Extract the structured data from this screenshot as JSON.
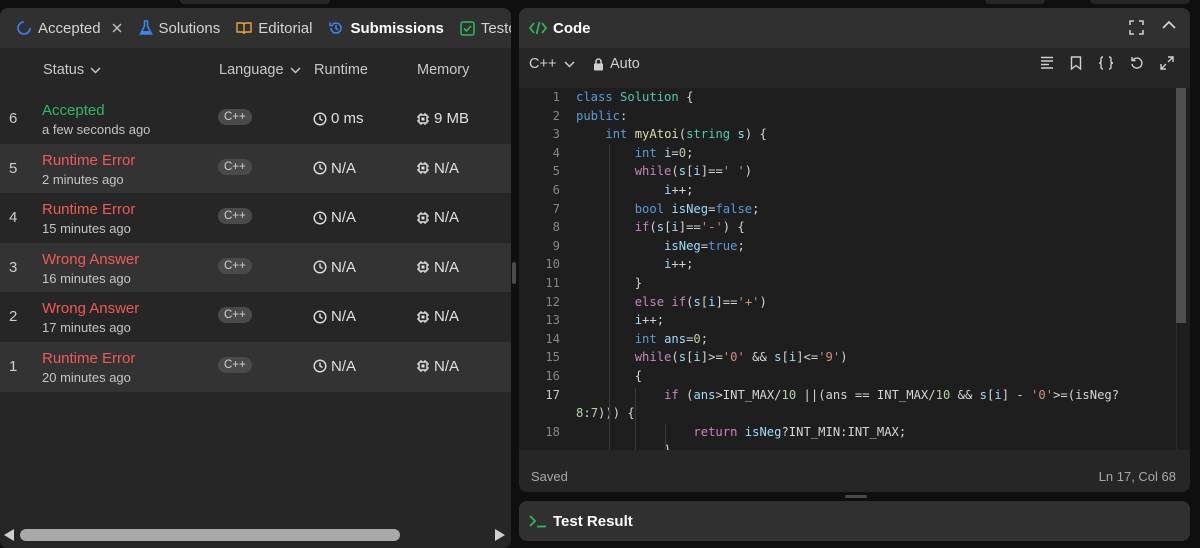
{
  "left_panel": {
    "tabs": [
      {
        "label": "Accepted",
        "icon": "history-icon"
      },
      {
        "label": "Solutions",
        "icon": "flask-icon"
      },
      {
        "label": "Editorial",
        "icon": "book-icon"
      },
      {
        "label": "Submissions",
        "icon": "history-icon"
      },
      {
        "label": "Testca",
        "icon": "check-box-icon"
      }
    ],
    "columns": {
      "status": "Status",
      "language": "Language",
      "runtime": "Runtime",
      "memory": "Memory"
    },
    "submissions": [
      {
        "num": "6",
        "status": "Accepted",
        "time": "a few seconds ago",
        "lang": "C++",
        "runtime": "0 ms",
        "memory": "9 MB"
      },
      {
        "num": "5",
        "status": "Runtime Error",
        "time": "2 minutes ago",
        "lang": "C++",
        "runtime": "N/A",
        "memory": "N/A"
      },
      {
        "num": "4",
        "status": "Runtime Error",
        "time": "15 minutes ago",
        "lang": "C++",
        "runtime": "N/A",
        "memory": "N/A"
      },
      {
        "num": "3",
        "status": "Wrong Answer",
        "time": "16 minutes ago",
        "lang": "C++",
        "runtime": "N/A",
        "memory": "N/A"
      },
      {
        "num": "2",
        "status": "Wrong Answer",
        "time": "17 minutes ago",
        "lang": "C++",
        "runtime": "N/A",
        "memory": "N/A"
      },
      {
        "num": "1",
        "status": "Runtime Error",
        "time": "20 minutes ago",
        "lang": "C++",
        "runtime": "N/A",
        "memory": "N/A"
      }
    ]
  },
  "code_panel": {
    "title": "Code",
    "language": "C++",
    "mode": "Auto",
    "status": "Saved",
    "cursor": "Ln 17, Col 68",
    "current_line": 17,
    "lines": [
      {
        "n": "1",
        "t": [
          [
            "kw",
            "class"
          ],
          [
            "op",
            " "
          ],
          [
            "type",
            "Solution"
          ],
          [
            "op",
            " {"
          ]
        ]
      },
      {
        "n": "2",
        "t": [
          [
            "kw",
            "public"
          ],
          [
            "op",
            ":"
          ]
        ]
      },
      {
        "n": "3",
        "t": [
          [
            "op",
            "    "
          ],
          [
            "kw",
            "int"
          ],
          [
            "op",
            " "
          ],
          [
            "fn",
            "myAtoi"
          ],
          [
            "op",
            "("
          ],
          [
            "type",
            "string"
          ],
          [
            "op",
            " "
          ],
          [
            "var",
            "s"
          ],
          [
            "op",
            ") {"
          ]
        ]
      },
      {
        "n": "4",
        "t": [
          [
            "op",
            "        "
          ],
          [
            "kw",
            "int"
          ],
          [
            "op",
            " "
          ],
          [
            "var",
            "i"
          ],
          [
            "op",
            "="
          ],
          [
            "num",
            "0"
          ],
          [
            "op",
            ";"
          ]
        ]
      },
      {
        "n": "5",
        "t": [
          [
            "op",
            "        "
          ],
          [
            "ctl",
            "while"
          ],
          [
            "op",
            "("
          ],
          [
            "var",
            "s"
          ],
          [
            "op",
            "["
          ],
          [
            "var",
            "i"
          ],
          [
            "op",
            "]=="
          ],
          [
            "str",
            "' '"
          ],
          [
            "op",
            ")"
          ]
        ]
      },
      {
        "n": "6",
        "t": [
          [
            "op",
            "            "
          ],
          [
            "var",
            "i"
          ],
          [
            "op",
            "++;"
          ]
        ]
      },
      {
        "n": "7",
        "t": [
          [
            "op",
            "        "
          ],
          [
            "kw",
            "bool"
          ],
          [
            "op",
            " "
          ],
          [
            "var",
            "isNeg"
          ],
          [
            "op",
            "="
          ],
          [
            "kw",
            "false"
          ],
          [
            "op",
            ";"
          ]
        ]
      },
      {
        "n": "8",
        "t": [
          [
            "op",
            "        "
          ],
          [
            "ctl",
            "if"
          ],
          [
            "op",
            "("
          ],
          [
            "var",
            "s"
          ],
          [
            "op",
            "["
          ],
          [
            "var",
            "i"
          ],
          [
            "op",
            "]=="
          ],
          [
            "str",
            "'-'"
          ],
          [
            "op",
            ") {"
          ]
        ]
      },
      {
        "n": "9",
        "t": [
          [
            "op",
            "            "
          ],
          [
            "var",
            "isNeg"
          ],
          [
            "op",
            "="
          ],
          [
            "kw",
            "true"
          ],
          [
            "op",
            ";"
          ]
        ]
      },
      {
        "n": "10",
        "t": [
          [
            "op",
            "            "
          ],
          [
            "var",
            "i"
          ],
          [
            "op",
            "++;"
          ]
        ]
      },
      {
        "n": "11",
        "t": [
          [
            "op",
            "        }"
          ]
        ]
      },
      {
        "n": "12",
        "t": [
          [
            "op",
            "        "
          ],
          [
            "ctl",
            "else"
          ],
          [
            "op",
            " "
          ],
          [
            "ctl",
            "if"
          ],
          [
            "op",
            "("
          ],
          [
            "var",
            "s"
          ],
          [
            "op",
            "["
          ],
          [
            "var",
            "i"
          ],
          [
            "op",
            "]=="
          ],
          [
            "str",
            "'+'"
          ],
          [
            "op",
            ")"
          ]
        ]
      },
      {
        "n": "13",
        "t": [
          [
            "op",
            "        "
          ],
          [
            "var",
            "i"
          ],
          [
            "op",
            "++;"
          ]
        ]
      },
      {
        "n": "14",
        "t": [
          [
            "op",
            "        "
          ],
          [
            "kw",
            "int"
          ],
          [
            "op",
            " "
          ],
          [
            "var",
            "ans"
          ],
          [
            "op",
            "="
          ],
          [
            "num",
            "0"
          ],
          [
            "op",
            ";"
          ]
        ]
      },
      {
        "n": "15",
        "t": [
          [
            "op",
            "        "
          ],
          [
            "ctl",
            "while"
          ],
          [
            "op",
            "("
          ],
          [
            "var",
            "s"
          ],
          [
            "op",
            "["
          ],
          [
            "var",
            "i"
          ],
          [
            "op",
            "]>="
          ],
          [
            "str",
            "'0'"
          ],
          [
            "op",
            " && "
          ],
          [
            "var",
            "s"
          ],
          [
            "op",
            "["
          ],
          [
            "var",
            "i"
          ],
          [
            "op",
            "]<="
          ],
          [
            "str",
            "'9'"
          ],
          [
            "op",
            ")"
          ]
        ]
      },
      {
        "n": "16",
        "t": [
          [
            "op",
            "        {"
          ]
        ]
      },
      {
        "n": "17",
        "t": [
          [
            "op",
            "            "
          ],
          [
            "ctl",
            "if"
          ],
          [
            "op",
            " ("
          ],
          [
            "var",
            "ans"
          ],
          [
            "op",
            ">INT_MAX/"
          ],
          [
            "num",
            "10"
          ],
          [
            "op",
            " ||(ans == INT_MAX/"
          ],
          [
            "num",
            "10"
          ],
          [
            "op",
            " && "
          ],
          [
            "var",
            "s"
          ],
          [
            "op",
            "["
          ],
          [
            "var",
            "i"
          ],
          [
            "op",
            "] - "
          ],
          [
            "str",
            "'0'"
          ],
          [
            "op",
            ">=(isNeg?"
          ]
        ]
      },
      {
        "n": "",
        "t": [
          [
            "num",
            "8"
          ],
          [
            "op",
            ":"
          ],
          [
            "num",
            "7"
          ],
          [
            "op",
            ")))"
          ],
          [
            "op",
            " {"
          ]
        ]
      },
      {
        "n": "18",
        "t": [
          [
            "op",
            "                "
          ],
          [
            "ctl",
            "return"
          ],
          [
            "op",
            " "
          ],
          [
            "var",
            "isNeg"
          ],
          [
            "op",
            "?INT_MIN:INT_MAX;"
          ]
        ]
      },
      {
        "n": "",
        "t": [
          [
            "op",
            "            }"
          ]
        ]
      }
    ]
  },
  "bottom_panel": {
    "title": "Test Result"
  },
  "colors": {
    "accepted": "#2cbb5d",
    "error": "#f05a54",
    "panel": "#262626",
    "header": "#303030",
    "editor": "#1e1e1e"
  }
}
